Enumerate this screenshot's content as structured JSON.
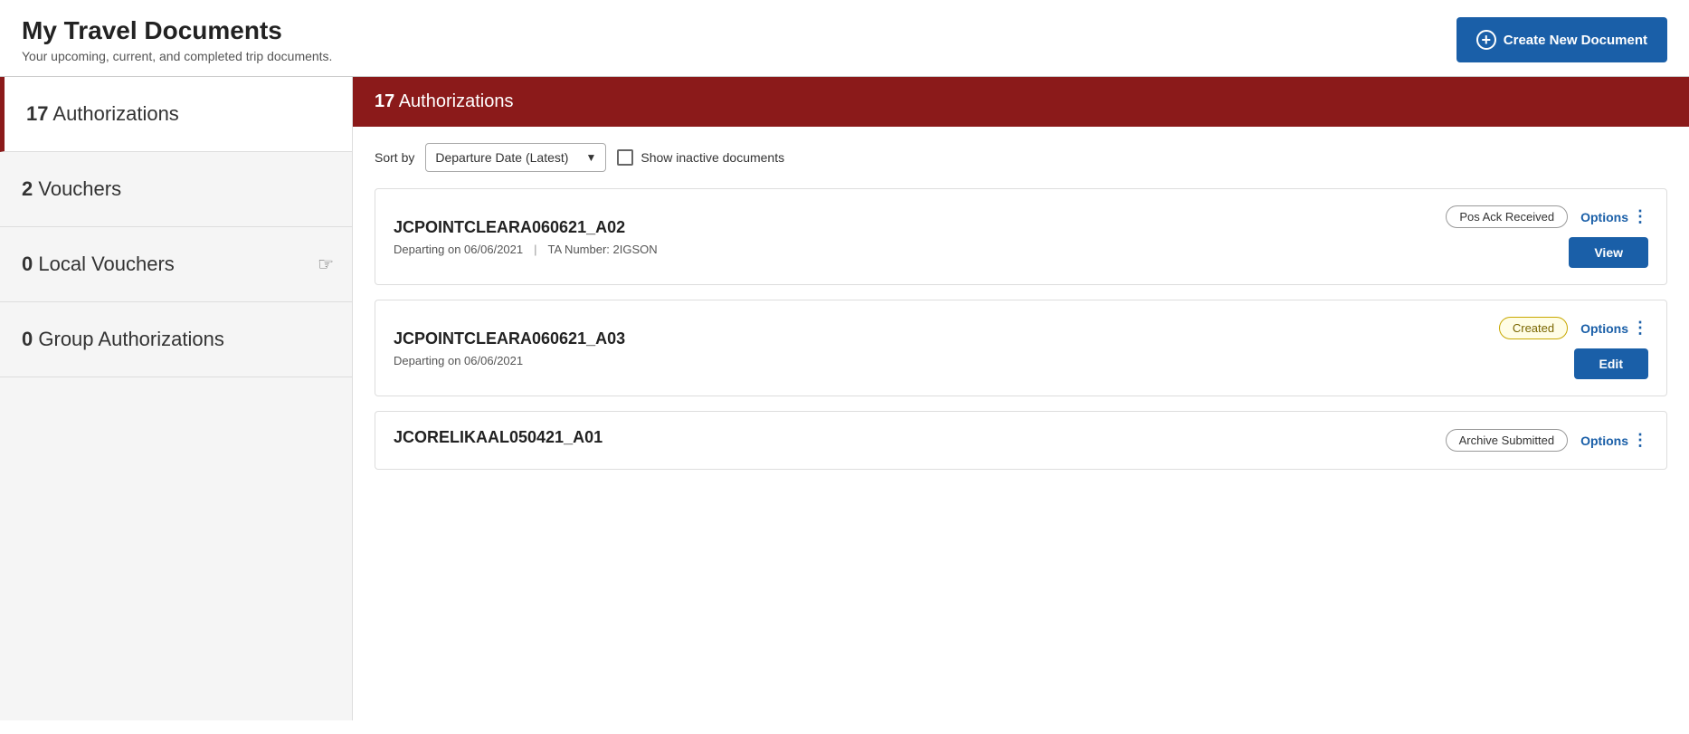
{
  "header": {
    "title": "My Travel Documents",
    "subtitle": "Your upcoming, current, and completed trip documents.",
    "create_btn_label": "Create New Document"
  },
  "sidebar": {
    "items": [
      {
        "id": "authorizations",
        "count": "17",
        "label": "Authorizations",
        "active": true
      },
      {
        "id": "vouchers",
        "count": "2",
        "label": "Vouchers",
        "active": false
      },
      {
        "id": "local-vouchers",
        "count": "0",
        "label": "Local Vouchers",
        "active": false
      },
      {
        "id": "group-authorizations",
        "count": "0",
        "label": "Group Authorizations",
        "active": false
      }
    ],
    "chevron": "<"
  },
  "content": {
    "section_count": "17",
    "section_label": "Authorizations",
    "toolbar": {
      "sort_label": "Sort by",
      "sort_value": "Departure Date (Latest)",
      "checkbox_label": "Show inactive documents"
    },
    "documents": [
      {
        "id": "doc1",
        "title": "JCPOINTCLEARA060621_A02",
        "departure": "Departing on 06/06/2021",
        "ta_number": "TA Number: 2IGSON",
        "status": "Pos Ack Received",
        "status_type": "pos-ack",
        "action_label": "View",
        "has_ta": true
      },
      {
        "id": "doc2",
        "title": "JCPOINTCLEARA060621_A03",
        "departure": "Departing on 06/06/2021",
        "ta_number": "",
        "status": "Created",
        "status_type": "created",
        "action_label": "Edit",
        "has_ta": false
      },
      {
        "id": "doc3",
        "title": "JCORELIKAAL050421_A01",
        "departure": "",
        "ta_number": "",
        "status": "Archive Submitted",
        "status_type": "archive",
        "action_label": "Options",
        "has_ta": false,
        "partial": true
      }
    ],
    "options_label": "Options",
    "options_icon": "⋮"
  }
}
